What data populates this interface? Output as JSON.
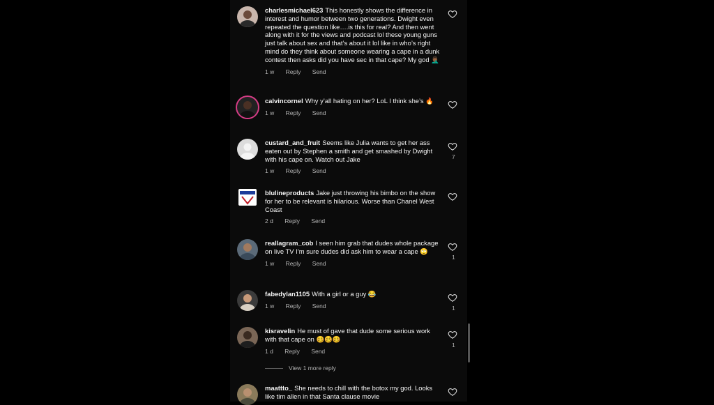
{
  "comments": [
    {
      "username": "charlesmichael623",
      "text": "This honestly shows the difference in interest and humor between two generations. Dwight even repeated the question like….is this for real? And then went along with it for the views and podcast lol these young guns just talk about sex and that’s about it lol like in who’s right mind do they think about someone wearing a cape in a dunk contest then asks did you have sec in that cape? My god 🤦🏾‍♂️",
      "time": "1 w",
      "reply": "Reply",
      "send": "Send",
      "likes": "",
      "avatar_icon": "person-photo"
    },
    {
      "username": "calvincornel",
      "text": "Why y’all hating on her?  LoL I think she’s 🔥",
      "time": "1 w",
      "reply": "Reply",
      "send": "Send",
      "likes": "",
      "avatar_icon": "person-photo"
    },
    {
      "username": "custard_and_fruit",
      "text": "Seems like Julia wants to get her ass eaten out by Stephen a smith and get smashed by Dwight with his cape on. Watch out Jake",
      "time": "1 w",
      "reply": "Reply",
      "send": "Send",
      "likes": "7",
      "avatar_icon": "default-profile"
    },
    {
      "username": "blulineproducts",
      "text": "Jake just throwing his bimbo on the show for her to be relevant is hilarious. Worse than Chanel West Coast",
      "time": "2 d",
      "reply": "Reply",
      "send": "Send",
      "likes": "",
      "avatar_icon": "logo"
    },
    {
      "username": "reallagram_cob",
      "text": "I seen him grab that dudes whole package on live TV I’m sure dudes did ask him to wear a cape 🙄",
      "time": "1 w",
      "reply": "Reply",
      "send": "Send",
      "likes": "1",
      "avatar_icon": "person-photo"
    },
    {
      "username": "fabedylan1105",
      "text": "With a girl or a guy 😂",
      "time": "1 w",
      "reply": "Reply",
      "send": "Send",
      "likes": "1",
      "avatar_icon": "person-photo"
    },
    {
      "username": "kisravelin",
      "text": "He must of gave that dude some serious work with that cape on 🥴🥴🥴",
      "time": "1 d",
      "reply": "Reply",
      "send": "Send",
      "likes": "1",
      "avatar_icon": "person-photo"
    },
    {
      "username": "maattto_",
      "text": "She needs to chill with the botox my god. Looks like tim allen in that Santa clause movie",
      "time": "",
      "reply": "",
      "send": "",
      "likes": "",
      "avatar_icon": "person-photo"
    }
  ],
  "view_more": "View 1 more reply",
  "colors": {
    "background": "#000000",
    "text": "#f5f5f5",
    "secondary": "#b4b4b4",
    "story_ring": "#d63c86"
  }
}
